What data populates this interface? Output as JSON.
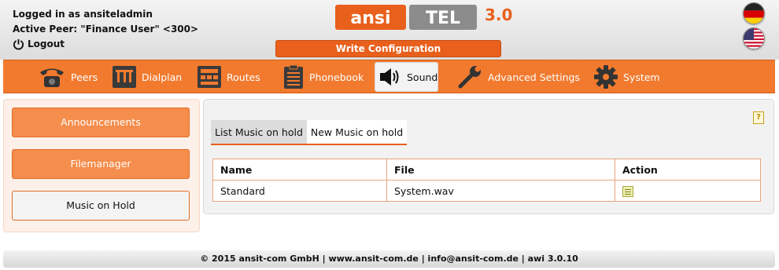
{
  "header": {
    "logged_in_text": "Logged in as ansiteladmin",
    "active_peer_text": "Active Peer: \"Finance User\" <300>",
    "logout_label": "Logout",
    "logo_text_left": "ansi",
    "logo_text_right": "TEL",
    "logo_version": "3.0",
    "write_config_label": "Write Configuration"
  },
  "nav": {
    "items": [
      {
        "label": "Peers",
        "icon": "telephone-icon"
      },
      {
        "label": "Dialplan",
        "icon": "dialplan-icon"
      },
      {
        "label": "Routes",
        "icon": "routes-icon"
      },
      {
        "label": "Phonebook",
        "icon": "phonebook-icon"
      },
      {
        "label": "Sound",
        "icon": "speaker-icon",
        "active": true
      },
      {
        "label": "Advanced Settings",
        "icon": "wrench-icon"
      },
      {
        "label": "System",
        "icon": "gear-icon"
      }
    ]
  },
  "sidebar": {
    "items": [
      {
        "label": "Announcements"
      },
      {
        "label": "Filemanager"
      },
      {
        "label": "Music on Hold",
        "active": true
      }
    ]
  },
  "content": {
    "help_label": "?",
    "tabs": [
      {
        "label": "List Music on hold",
        "active": true
      },
      {
        "label": "New Music on hold"
      }
    ],
    "table": {
      "headers": [
        "Name",
        "File",
        "Action"
      ],
      "rows": [
        {
          "name": "Standard",
          "file": "System.wav",
          "action": "edit-icon"
        }
      ]
    }
  },
  "footer": {
    "text": "© 2015 ansit-com GmbH | www.ansit-com.de | info@ansit-com.de | awi 3.0.10"
  },
  "colors": {
    "accent": "#f27a2e",
    "accent_dark": "#e8601c",
    "sidebar_bg": "#fdf0e8"
  }
}
